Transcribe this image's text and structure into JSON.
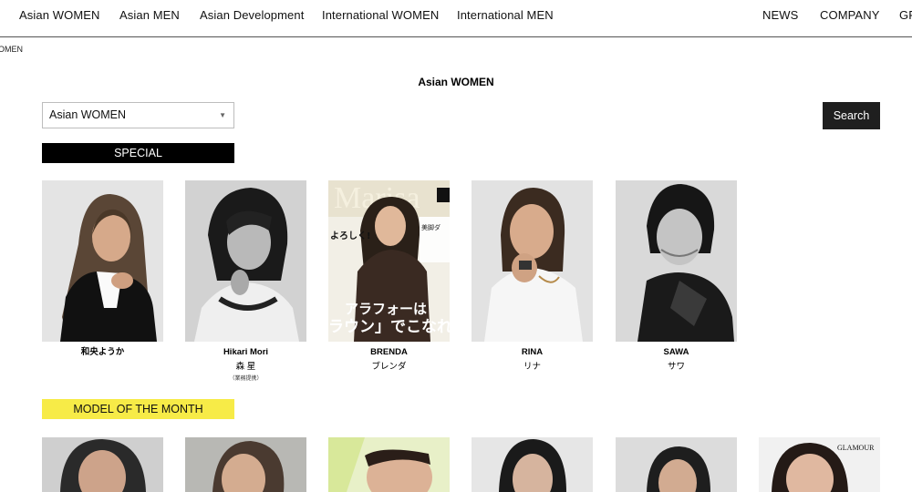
{
  "nav": {
    "left": [
      "Asian WOMEN",
      "Asian MEN",
      "Asian Development",
      "International WOMEN",
      "International MEN"
    ],
    "right": [
      "NEWS",
      "COMPANY",
      "GR"
    ]
  },
  "breadcrumb": "OMEN",
  "page_title": "Asian WOMEN",
  "filter": {
    "selected": "Asian WOMEN",
    "search_label": "Search"
  },
  "sections": {
    "special": "SPECIAL",
    "model_of_month": "MODEL OF THE MONTH"
  },
  "special_models": [
    {
      "name_en": "和央ようか",
      "name_jp": "",
      "note": ""
    },
    {
      "name_en": "Hikari Mori",
      "name_jp": "森 星",
      "note": "（業務提携）"
    },
    {
      "name_en": "BRENDA",
      "name_jp": "ブレンダ",
      "note": ""
    },
    {
      "name_en": "RINA",
      "name_jp": "リナ",
      "note": ""
    },
    {
      "name_en": "SAWA",
      "name_jp": "サワ",
      "note": ""
    }
  ],
  "magazine_cover": {
    "masthead": "Marisa",
    "headline": "アラフォーは",
    "headline2": "ラウン」でこなれ",
    "side1": "よろしく!",
    "side2": "美脚ダ"
  },
  "month_cover_masthead": "GLAMOUR"
}
